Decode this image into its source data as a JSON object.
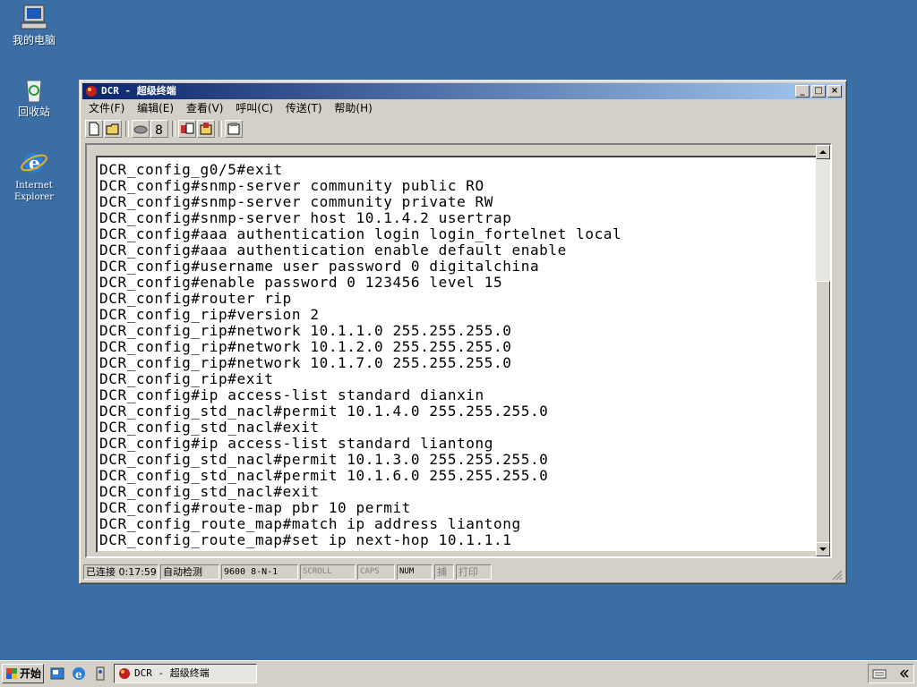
{
  "desktop": {
    "icons": [
      {
        "label": "我的电脑",
        "icon": "my-computer-icon"
      },
      {
        "label": "回收站",
        "icon": "recycle-bin-icon"
      },
      {
        "label_line1": "Internet",
        "label_line2": "Explorer",
        "icon": "internet-explorer-icon"
      }
    ]
  },
  "window": {
    "title": "DCR - 超级终端",
    "controls": {
      "minimize": "_",
      "maximize": "□",
      "close": "×"
    },
    "menu": [
      "文件(F)",
      "编辑(E)",
      "查看(V)",
      "呼叫(C)",
      "传送(T)",
      "帮助(H)"
    ],
    "toolbar": [
      "new-icon",
      "open-icon",
      "phone-icon",
      "disconnect-icon",
      "send-icon",
      "receive-icon",
      "properties-icon"
    ],
    "terminal_lines": [
      "DCR_config_g0/5#exit",
      "DCR_config#snmp-server community public RO",
      "DCR_config#snmp-server community private RW",
      "DCR_config#snmp-server host 10.1.4.2 usertrap",
      "DCR_config#aaa authentication login login_fortelnet local",
      "DCR_config#aaa authentication enable default enable",
      "DCR_config#username user password 0 digitalchina",
      "DCR_config#enable password 0 123456 level 15",
      "DCR_config#router rip",
      "DCR_config_rip#version 2",
      "DCR_config_rip#network 10.1.1.0 255.255.255.0",
      "DCR_config_rip#network 10.1.2.0 255.255.255.0",
      "DCR_config_rip#network 10.1.7.0 255.255.255.0",
      "DCR_config_rip#exit",
      "DCR_config#ip access-list standard dianxin",
      "DCR_config_std_nacl#permit 10.1.4.0 255.255.255.0",
      "DCR_config_std_nacl#exit",
      "DCR_config#ip access-list standard liantong",
      "DCR_config_std_nacl#permit 10.1.3.0 255.255.255.0",
      "DCR_config_std_nacl#permit 10.1.6.0 255.255.255.0",
      "DCR_config_std_nacl#exit",
      "DCR_config#route-map pbr 10 permit",
      "DCR_config_route_map#match ip address liantong",
      "DCR_config_route_map#set ip next-hop 10.1.1.1"
    ],
    "status": {
      "connected": "已连接 0:17:59",
      "detect": "自动检测",
      "baud": "9600 8-N-1",
      "scroll": "SCROLL",
      "caps": "CAPS",
      "num": "NUM",
      "capture": "捕",
      "print": "打印"
    }
  },
  "taskbar": {
    "start": "开始",
    "task_title": "DCR - 超级终端",
    "quick_launch": [
      "show-desktop-icon",
      "internet-explorer-icon",
      "system-icon"
    ],
    "tray": [
      "keyboard-icon",
      "chevron-icon"
    ]
  },
  "colors": {
    "desktop": "#3a6ea5",
    "title_start": "#0a246a",
    "title_end": "#a6caf0",
    "face": "#d4d0c8"
  }
}
